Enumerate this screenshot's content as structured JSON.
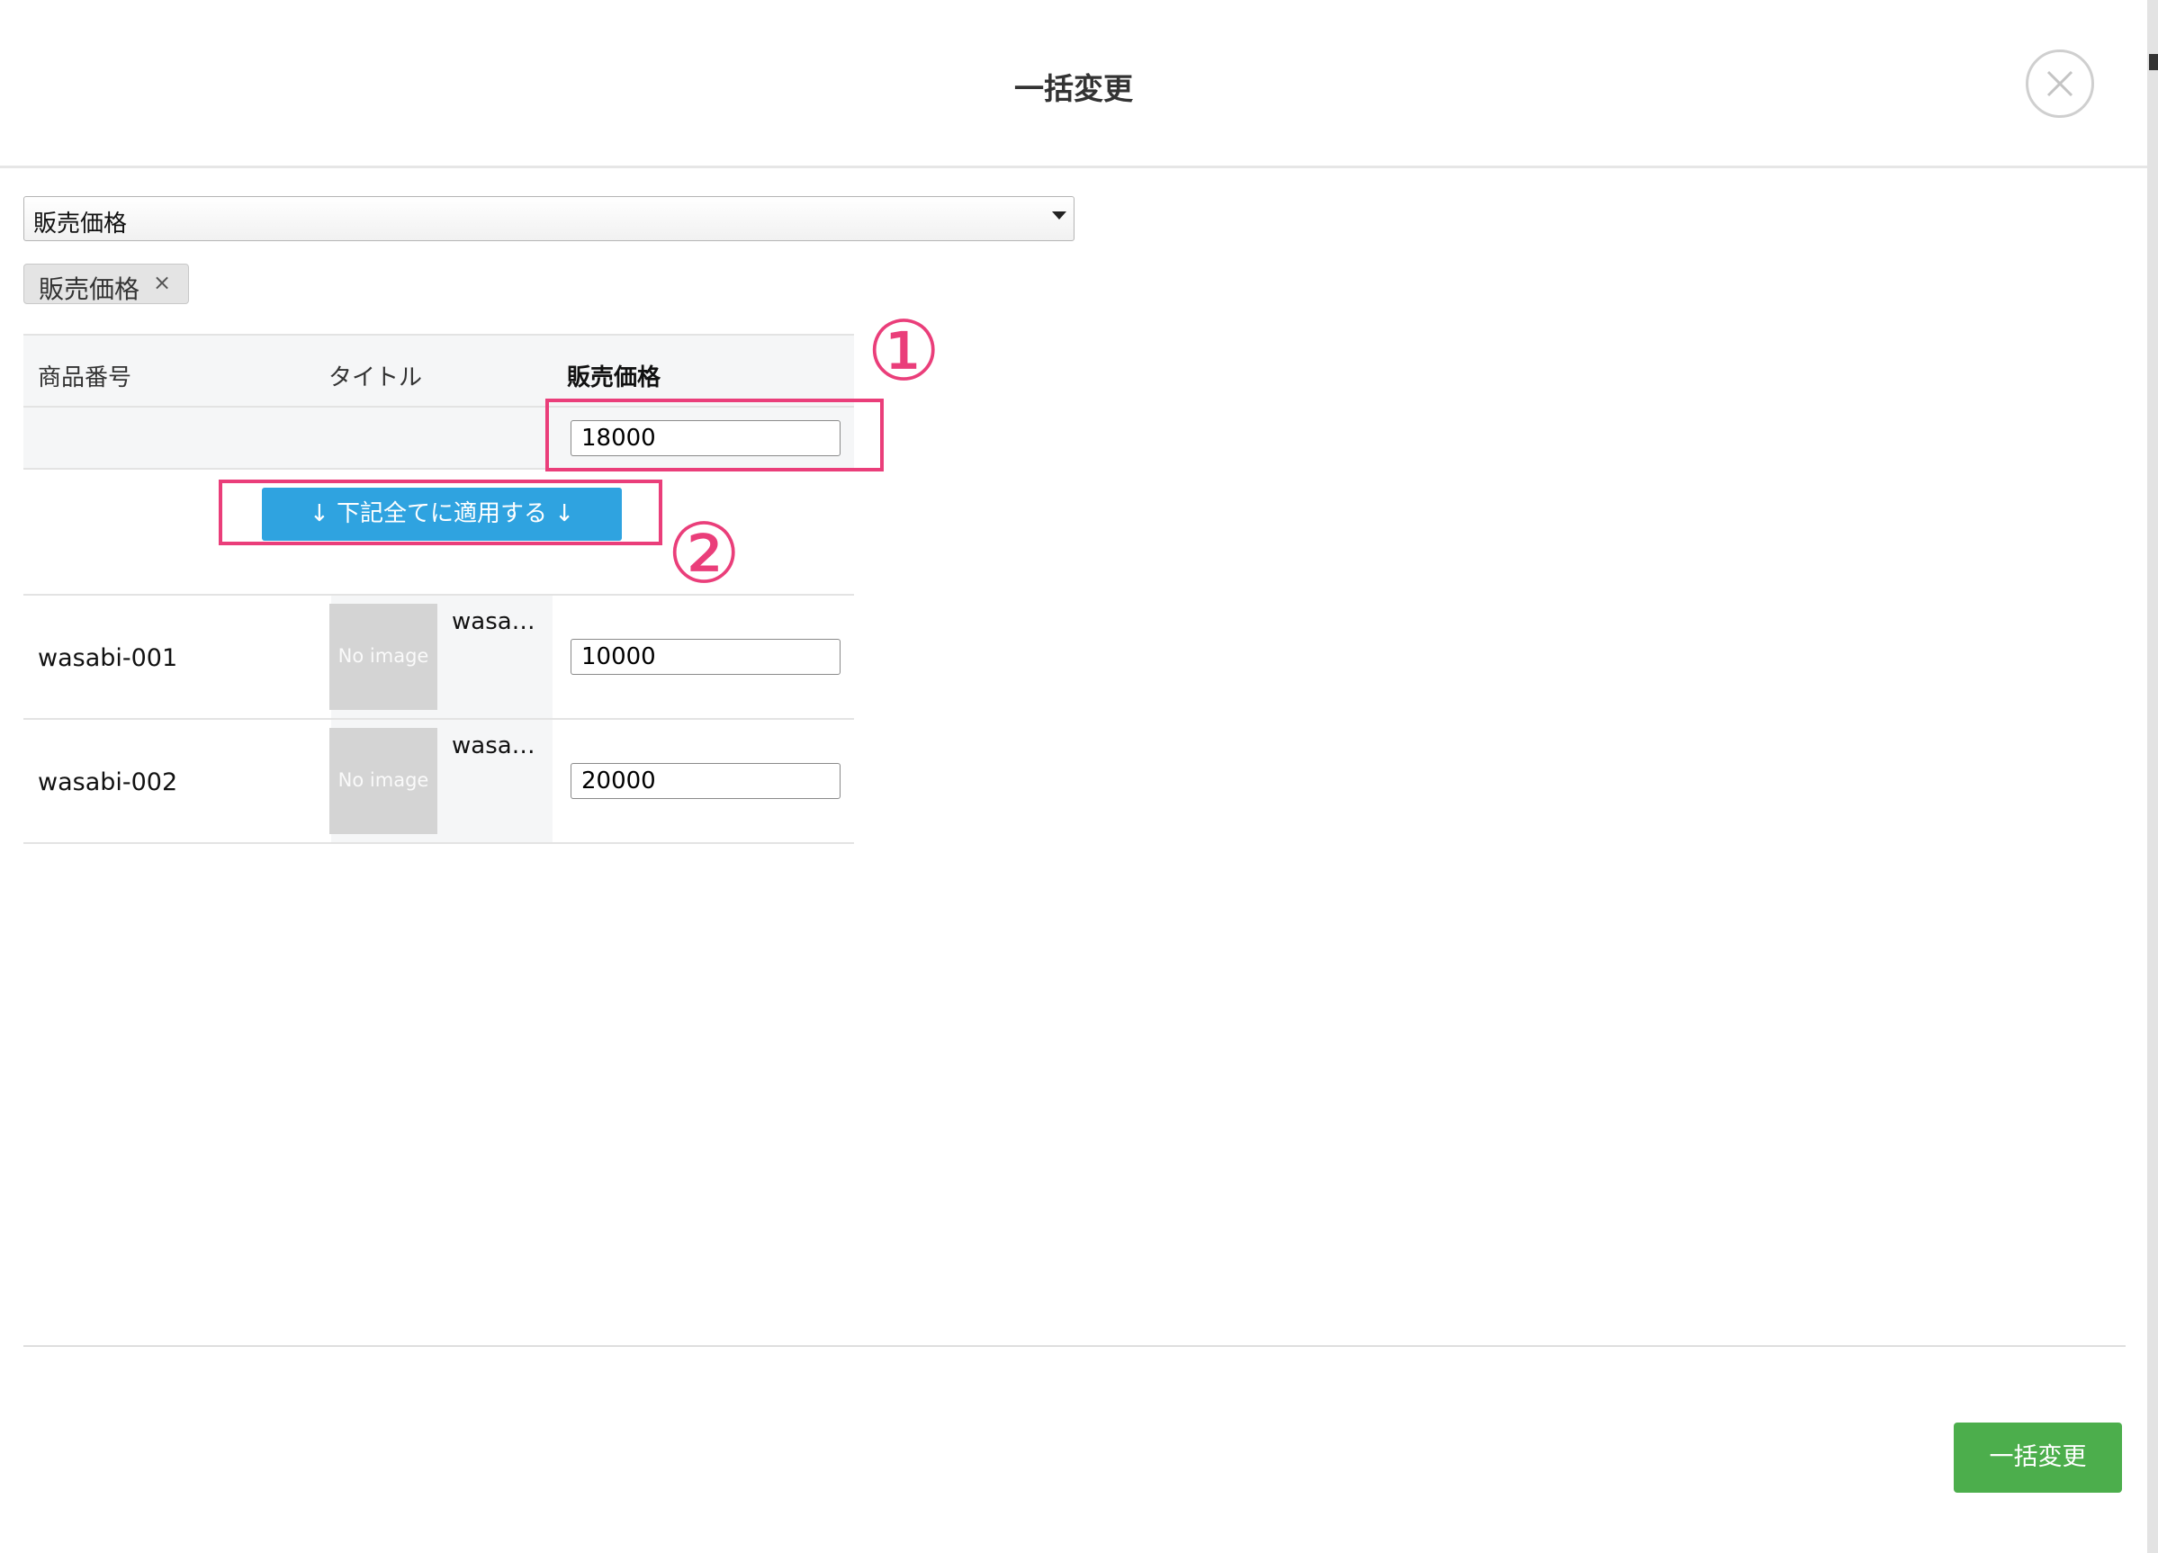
{
  "dialog": {
    "title": "一括変更",
    "close_icon": "close-icon"
  },
  "field_select": {
    "selected": "販売価格"
  },
  "selected_chip": {
    "label": "販売価格",
    "remove": "×"
  },
  "table": {
    "headers": {
      "code": "商品番号",
      "title": "タイトル",
      "price": "販売価格"
    },
    "bulk_value": "18000",
    "apply_button": "↓ 下記全てに適用する ↓",
    "rows": [
      {
        "code": "wasabi-001",
        "image": "No image",
        "title": "wasa…",
        "price": "10000"
      },
      {
        "code": "wasabi-002",
        "image": "No image",
        "title": "wasa…",
        "price": "20000"
      }
    ]
  },
  "annotations": {
    "one": "①",
    "two": "②",
    "color": "#ea3e7a"
  },
  "footer": {
    "submit_button": "一括変更",
    "submit_color": "#4cae4c"
  }
}
